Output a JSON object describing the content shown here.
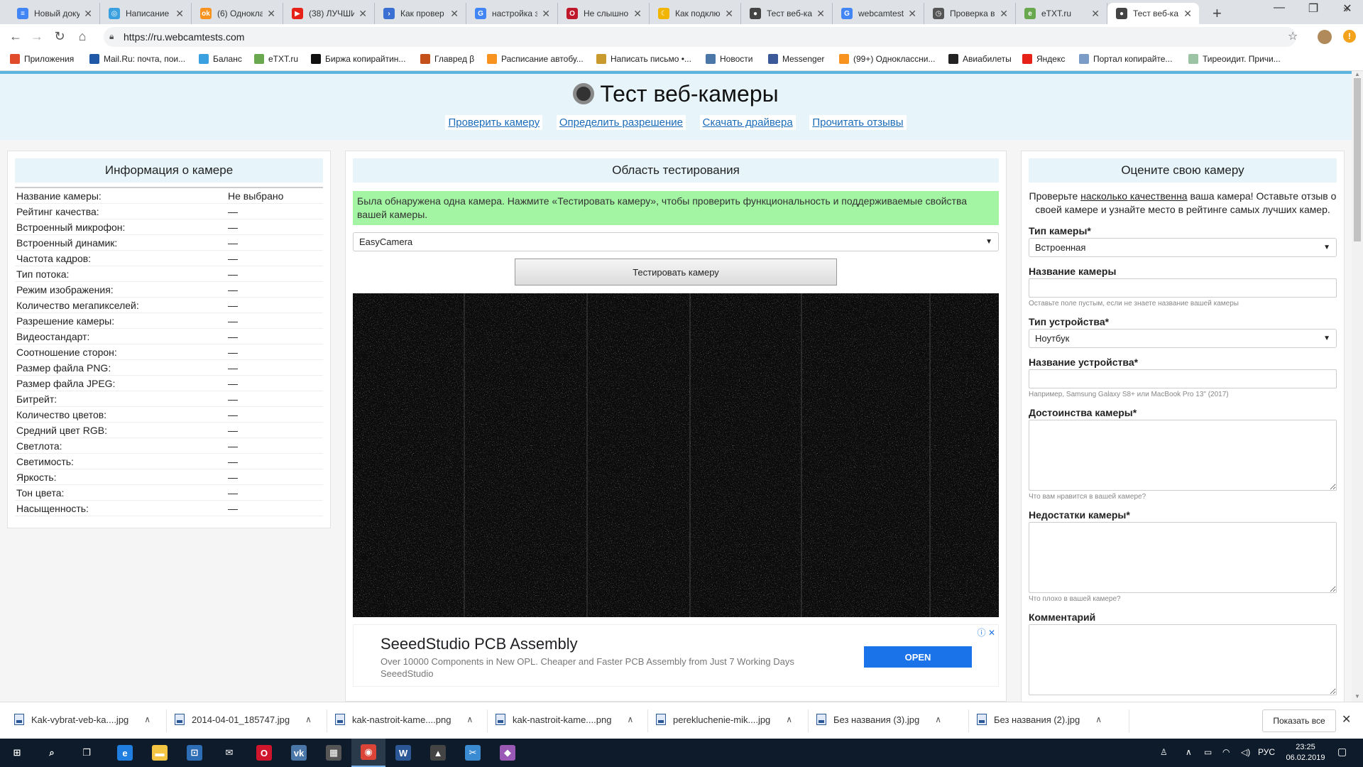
{
  "browser": {
    "tabs": [
      {
        "label": "Новый доку",
        "favicon": "docs-icon",
        "color": "#4285f4",
        "glyph": "≡"
      },
      {
        "label": "Написание",
        "favicon": "circle-icon",
        "color": "#3aa0e0",
        "glyph": "◎"
      },
      {
        "label": "(6) Однокла",
        "favicon": "ok-icon",
        "color": "#f7931e",
        "glyph": "ok"
      },
      {
        "label": "(38) ЛУЧШИ",
        "favicon": "youtube-icon",
        "color": "#e62117",
        "glyph": "▶"
      },
      {
        "label": "Как провер",
        "favicon": "link-icon",
        "color": "#3b6fd4",
        "glyph": "›"
      },
      {
        "label": "настройка з",
        "favicon": "google-icon",
        "color": "#4285f4",
        "glyph": "G"
      },
      {
        "label": "Не слышно",
        "favicon": "opera-icon",
        "color": "#c0182b",
        "glyph": "O"
      },
      {
        "label": "Как подклю",
        "favicon": "moon-icon",
        "color": "#f1b500",
        "glyph": "☾"
      },
      {
        "label": "Тест веб-ка",
        "favicon": "webcam-icon",
        "color": "#444444",
        "glyph": "●"
      },
      {
        "label": "webcamtest",
        "favicon": "google-icon",
        "color": "#4285f4",
        "glyph": "G"
      },
      {
        "label": "Проверка в",
        "favicon": "clock-icon",
        "color": "#555555",
        "glyph": "◷"
      },
      {
        "label": "eTXT.ru",
        "favicon": "etxt-icon",
        "color": "#6aa84f",
        "glyph": "e"
      },
      {
        "label": "Тест веб-ка",
        "favicon": "webcam-icon",
        "color": "#444444",
        "glyph": "●"
      }
    ],
    "url": "https://ru.webcamtests.com",
    "bookmarks": [
      {
        "label": "Приложения",
        "color": "#e04b2b"
      },
      {
        "label": "Mail.Ru: почта, пои...",
        "color": "#1e58a6"
      },
      {
        "label": "Баланс",
        "color": "#3aa0e0"
      },
      {
        "label": "eTXT.ru",
        "color": "#6aa84f"
      },
      {
        "label": "Биржа копирайтин...",
        "color": "#111111"
      },
      {
        "label": "Главред β",
        "color": "#c5511a"
      },
      {
        "label": "Расписание автобу...",
        "color": "#f7931e"
      },
      {
        "label": "Написать письмо •...",
        "color": "#c99a2e"
      },
      {
        "label": "Новости",
        "color": "#4a76a8"
      },
      {
        "label": "Messenger",
        "color": "#3b5998"
      },
      {
        "label": "(99+) Одноклассни...",
        "color": "#f7931e"
      },
      {
        "label": "Авиабилеты",
        "color": "#222222"
      },
      {
        "label": "Яндекс",
        "color": "#e62117"
      },
      {
        "label": "Портал копирайте...",
        "color": "#7a9cc6"
      },
      {
        "label": "Тиреоидит. Причи...",
        "color": "#9dc3a5"
      }
    ]
  },
  "header": {
    "title": "Тест веб-камеры",
    "nav": [
      "Проверить камеру",
      "Определить разрешение",
      "Скачать драйвера",
      "Прочитать отзывы"
    ]
  },
  "info_panel": {
    "title": "Информация о камере",
    "rows": [
      {
        "key": "Название камеры:",
        "value": "Не выбрано"
      },
      {
        "key": "Рейтинг качества:",
        "value": "—"
      },
      {
        "key": "Встроенный микрофон:",
        "value": "—"
      },
      {
        "key": "Встроенный динамик:",
        "value": "—"
      },
      {
        "key": "Частота кадров:",
        "value": "—"
      },
      {
        "key": "Тип потока:",
        "value": "—"
      },
      {
        "key": "Режим изображения:",
        "value": "—"
      },
      {
        "key": "Количество мегапикселей:",
        "value": "—"
      },
      {
        "key": "Разрешение камеры:",
        "value": "—"
      },
      {
        "key": "Видеостандарт:",
        "value": "—"
      },
      {
        "key": "Соотношение сторон:",
        "value": "—"
      },
      {
        "key": "Размер файла PNG:",
        "value": "—"
      },
      {
        "key": "Размер файла JPEG:",
        "value": "—"
      },
      {
        "key": "Битрейт:",
        "value": "—"
      },
      {
        "key": "Количество цветов:",
        "value": "—"
      },
      {
        "key": "Средний цвет RGB:",
        "value": "—"
      },
      {
        "key": "Светлота:",
        "value": "—"
      },
      {
        "key": "Светимость:",
        "value": "—"
      },
      {
        "key": "Яркость:",
        "value": "—"
      },
      {
        "key": "Тон цвета:",
        "value": "—"
      },
      {
        "key": "Насыщенность:",
        "value": "—"
      }
    ]
  },
  "test_panel": {
    "title": "Область тестирования",
    "notice": "Была обнаружена одна камера. Нажмите «Тестировать камеру», чтобы проверить функциональность и поддерживаемые свойства вашей камеры.",
    "camera_select": "EasyCamera",
    "test_button": "Тестировать камеру",
    "ad": {
      "title": "SeeedStudio PCB Assembly",
      "description": "Over 10000 Components in New OPL. Cheaper and Faster PCB Assembly from Just 7 Working Days",
      "source": "SeeedStudio",
      "button": "OPEN"
    }
  },
  "rate_panel": {
    "title": "Оцените свою камеру",
    "intro_before": "Проверьте ",
    "intro_link": "насколько качественна",
    "intro_after": " ваша камера! Оставьте отзыв о своей камере и узнайте место в рейтинге самых лучших камер.",
    "camera_type_label": "Тип камеры*",
    "camera_type_value": "Встроенная",
    "camera_name_label": "Название камеры",
    "camera_name_hint": "Оставьте поле пустым, если не знаете название вашей камеры",
    "device_type_label": "Тип устройства*",
    "device_type_value": "Ноутбук",
    "device_name_label": "Название устройства*",
    "device_name_hint": "Например, Samsung Galaxy S8+ или MacBook Pro 13\" (2017)",
    "pros_label": "Достоинства камеры*",
    "pros_hint": "Что вам нравится в вашей камере?",
    "cons_label": "Недостатки камеры*",
    "cons_hint": "Что плохо в вашей камере?",
    "comment_label": "Комментарий"
  },
  "downloads": {
    "files": [
      "Kak-vybrat-veb-ka....jpg",
      "2014-04-01_185747.jpg",
      "kak-nastroit-kame....png",
      "kak-nastroit-kame....png",
      "perekluchenie-mik....jpg",
      "Без названия (3).jpg",
      "Без названия (2).jpg"
    ],
    "show_all": "Показать все"
  },
  "taskbar": {
    "apps": [
      {
        "name": "start-icon",
        "color": "transparent",
        "glyph": "⊞"
      },
      {
        "name": "search-icon",
        "color": "transparent",
        "glyph": "⌕"
      },
      {
        "name": "task-view-icon",
        "color": "transparent",
        "glyph": "❐"
      },
      {
        "name": "edge-icon",
        "color": "#1f7ee0",
        "glyph": "e"
      },
      {
        "name": "explorer-icon",
        "color": "#f4c542",
        "glyph": "▬"
      },
      {
        "name": "store-icon",
        "color": "#2d6db5",
        "glyph": "⊡"
      },
      {
        "name": "mail-icon",
        "color": "transparent",
        "glyph": "✉"
      },
      {
        "name": "opera-icon",
        "color": "#d0162c",
        "glyph": "O"
      },
      {
        "name": "vk-icon",
        "color": "#4a76a8",
        "glyph": "vk"
      },
      {
        "name": "calculator-icon",
        "color": "#555555",
        "glyph": "▦"
      },
      {
        "name": "chrome-icon",
        "color": "#db4437",
        "glyph": "◉"
      },
      {
        "name": "word-icon",
        "color": "#2b5797",
        "glyph": "W"
      },
      {
        "name": "photos-icon",
        "color": "#444444",
        "glyph": "▲"
      },
      {
        "name": "snipping-icon",
        "color": "#3a8bd1",
        "glyph": "✂"
      },
      {
        "name": "paint3d-icon",
        "color": "#9b59b6",
        "glyph": "◆"
      }
    ],
    "language": "РУС",
    "time": "23:25",
    "date": "06.02.2019"
  }
}
